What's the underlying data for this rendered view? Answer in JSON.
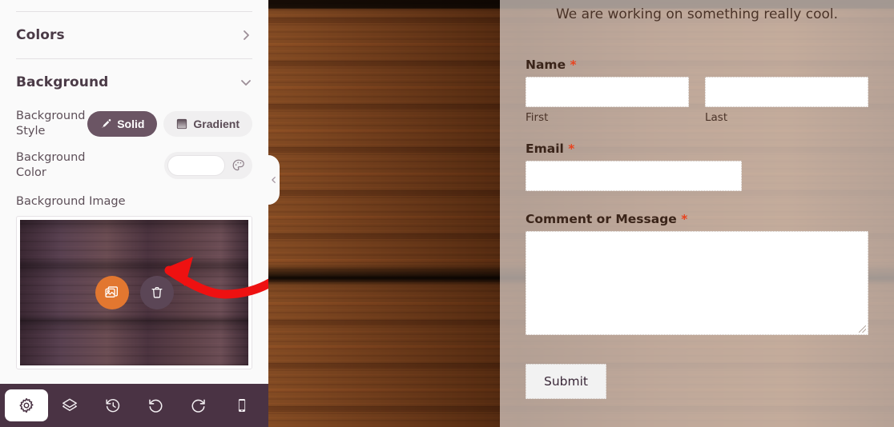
{
  "settings_panel": {
    "sections": [
      {
        "title": "Colors",
        "chevron": "chevron-right-icon",
        "expanded": false
      },
      {
        "title": "Background",
        "chevron": "chevron-down-icon",
        "expanded": true
      }
    ],
    "background_style": {
      "label": "Background Style",
      "options": [
        {
          "label": "Solid",
          "icon": "paintbrush-icon",
          "active": true
        },
        {
          "label": "Gradient",
          "icon": "gradient-icon",
          "active": false
        }
      ]
    },
    "background_color": {
      "label": "Background Color",
      "value": "#ffffff",
      "picker_icon": "palette-icon"
    },
    "background_image": {
      "label": "Background Image",
      "actions": [
        {
          "name": "replace-image",
          "icon": "images-icon",
          "color": "#e27730"
        },
        {
          "name": "delete-image",
          "icon": "trash-icon",
          "color": "#5b4656"
        }
      ]
    },
    "collapse_handle_icon": "chevron-left-icon"
  },
  "toolbar": {
    "items": [
      {
        "name": "settings",
        "icon": "gear-icon",
        "active": true
      },
      {
        "name": "layers",
        "icon": "layers-icon",
        "active": false
      },
      {
        "name": "revisions",
        "icon": "history-clock-icon",
        "active": false
      },
      {
        "name": "undo",
        "icon": "undo-icon",
        "active": false
      },
      {
        "name": "redo",
        "icon": "redo-icon",
        "active": false
      },
      {
        "name": "responsive-preview",
        "icon": "mobile-icon",
        "active": false
      }
    ]
  },
  "preview": {
    "heading": "We are working on something really cool.",
    "fields": [
      {
        "label": "Name",
        "required": "*",
        "subfields": [
          {
            "sub_label": "First",
            "value": ""
          },
          {
            "sub_label": "Last",
            "value": ""
          }
        ]
      },
      {
        "label": "Email",
        "required": "*",
        "value": ""
      },
      {
        "label": "Comment or Message",
        "required": "*",
        "value": ""
      }
    ],
    "submit_label": "Submit"
  },
  "annotation": {
    "type": "arrow",
    "color": "#ee1111",
    "points_to": "delete-image"
  },
  "colors": {
    "panel_bg": "#fafafa",
    "accent_orange": "#e27730",
    "toolbar_bg": "#4a3344",
    "pill_active_bg": "#6b5564",
    "required_red": "#e8431f"
  }
}
